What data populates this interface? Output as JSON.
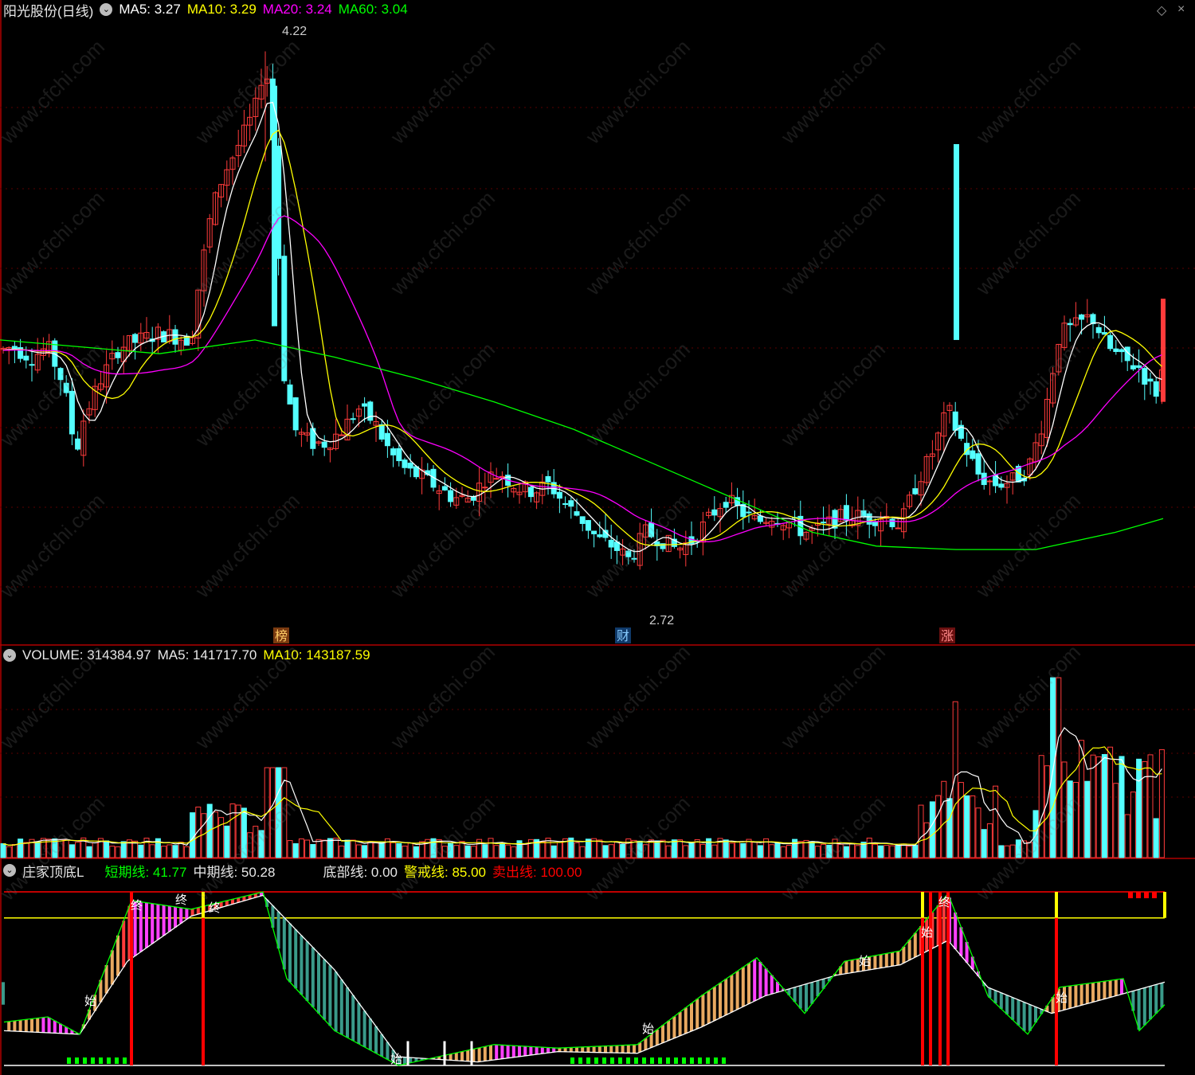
{
  "price_panel": {
    "title": "阳光股份(日线)",
    "ma5_label": "MA5: 3.27",
    "ma10_label": "MA10: 3.29",
    "ma20_label": "MA20: 3.24",
    "ma60_label": "MA60: 3.04",
    "high_label": "4.22",
    "low_label": "2.72",
    "markers": [
      "榜",
      "财",
      "涨"
    ]
  },
  "volume_panel": {
    "volume_label": "VOLUME: 314384.97",
    "ma5_label": "MA5: 141717.70",
    "ma10_label": "MA10: 143187.59"
  },
  "indicator_panel": {
    "name": "庄家顶底L",
    "short_line": "短期线: 41.77",
    "mid_line": "中期线: 50.28",
    "bottom_line": "底部线: 0.00",
    "warn_line": "警戒线: 85.00",
    "sell_line": "卖出线: 100.00",
    "start_glyph": "始",
    "end_glyph": "终"
  },
  "watermark": "www.cfchi.com",
  "colors": {
    "up": "#ff3b3b",
    "down": "#54ffff",
    "ma5": "#ffffff",
    "ma10": "#ffff00",
    "ma20": "#ff00ff",
    "ma60": "#00ff00",
    "separator": "#b00000",
    "short": "#00ff00",
    "mid": "#ffffff",
    "bottom": "#ffffff",
    "warn": "#ffff00",
    "sell": "#ff0000",
    "hist_tan": "#e8a860",
    "hist_pink": "#ff40ff",
    "hist_teal": "#3a9a8a"
  },
  "chart_data": {
    "type": "candlestick",
    "price_ylim": [
      2.55,
      4.3
    ],
    "price_points": [
      [
        0,
        3.35
      ],
      [
        15,
        3.36
      ],
      [
        40,
        3.33
      ],
      [
        60,
        3.36
      ],
      [
        80,
        3.25
      ],
      [
        95,
        3.05
      ],
      [
        105,
        3.15
      ],
      [
        125,
        3.26
      ],
      [
        150,
        3.36
      ],
      [
        175,
        3.38
      ],
      [
        200,
        3.4
      ],
      [
        220,
        3.39
      ],
      [
        240,
        3.38
      ],
      [
        250,
        3.55
      ],
      [
        265,
        3.75
      ],
      [
        280,
        3.86
      ],
      [
        300,
        3.95
      ],
      [
        320,
        4.05
      ],
      [
        333,
        4.2
      ],
      [
        345,
        3.9
      ],
      [
        355,
        3.3
      ],
      [
        370,
        3.12
      ],
      [
        390,
        3.08
      ],
      [
        410,
        3.08
      ],
      [
        430,
        3.12
      ],
      [
        450,
        3.18
      ],
      [
        470,
        3.14
      ],
      [
        490,
        3.05
      ],
      [
        510,
        3.0
      ],
      [
        530,
        2.98
      ],
      [
        550,
        2.95
      ],
      [
        570,
        2.92
      ],
      [
        590,
        2.92
      ],
      [
        610,
        2.98
      ],
      [
        630,
        2.99
      ],
      [
        650,
        2.95
      ],
      [
        670,
        2.94
      ],
      [
        690,
        2.96
      ],
      [
        710,
        2.9
      ],
      [
        730,
        2.86
      ],
      [
        750,
        2.8
      ],
      [
        770,
        2.78
      ],
      [
        790,
        2.74
      ],
      [
        810,
        2.82
      ],
      [
        830,
        2.8
      ],
      [
        850,
        2.77
      ],
      [
        870,
        2.8
      ],
      [
        890,
        2.86
      ],
      [
        910,
        2.92
      ],
      [
        930,
        2.88
      ],
      [
        950,
        2.85
      ],
      [
        970,
        2.87
      ],
      [
        990,
        2.85
      ],
      [
        1010,
        2.82
      ],
      [
        1030,
        2.83
      ],
      [
        1050,
        2.86
      ],
      [
        1070,
        2.87
      ],
      [
        1090,
        2.86
      ],
      [
        1110,
        2.87
      ],
      [
        1130,
        2.84
      ],
      [
        1150,
        2.96
      ],
      [
        1170,
        3.05
      ],
      [
        1190,
        3.18
      ],
      [
        1200,
        3.12
      ],
      [
        1215,
        3.05
      ],
      [
        1230,
        2.98
      ],
      [
        1250,
        2.96
      ],
      [
        1270,
        2.97
      ],
      [
        1290,
        3.0
      ],
      [
        1310,
        3.15
      ],
      [
        1330,
        3.4
      ],
      [
        1350,
        3.42
      ],
      [
        1370,
        3.45
      ],
      [
        1390,
        3.36
      ],
      [
        1410,
        3.32
      ],
      [
        1430,
        3.3
      ],
      [
        1450,
        3.22
      ],
      [
        1460,
        3.3
      ]
    ],
    "ma60_points": [
      [
        0,
        3.38
      ],
      [
        100,
        3.36
      ],
      [
        200,
        3.34
      ],
      [
        320,
        3.38
      ],
      [
        420,
        3.33
      ],
      [
        520,
        3.27
      ],
      [
        620,
        3.2
      ],
      [
        720,
        3.12
      ],
      [
        820,
        3.02
      ],
      [
        920,
        2.92
      ],
      [
        1020,
        2.82
      ],
      [
        1100,
        2.78
      ],
      [
        1200,
        2.77
      ],
      [
        1300,
        2.77
      ],
      [
        1400,
        2.82
      ],
      [
        1460,
        2.86
      ]
    ],
    "volume_ylim": [
      0,
      320000
    ],
    "volume_series": [
      {
        "name": "VOLUME",
        "last": 314384.97
      },
      {
        "name": "MA5",
        "last": 141717.7
      },
      {
        "name": "MA10",
        "last": 143187.59
      }
    ],
    "indicator_ylim": [
      0,
      100
    ],
    "indicator_levels": {
      "bottom": 0,
      "warn": 85,
      "sell": 100
    },
    "short_last": 41.77,
    "mid_last": 50.28
  }
}
